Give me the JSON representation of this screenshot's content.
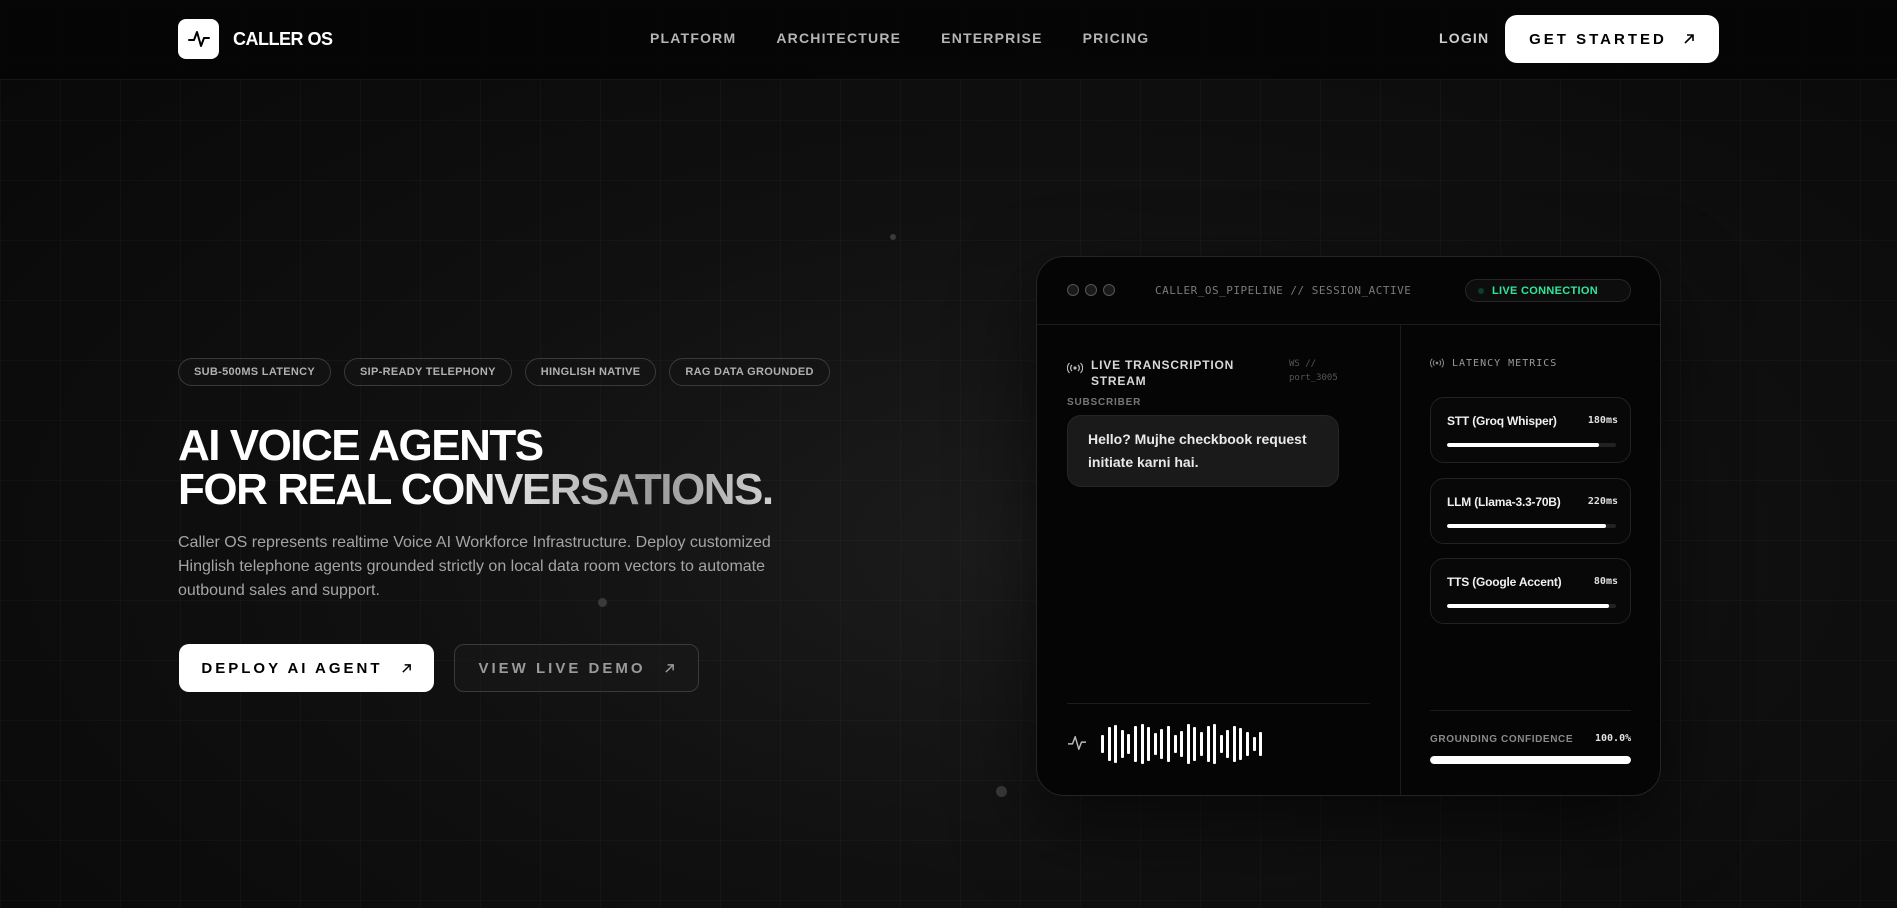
{
  "brand": {
    "name": "CALLER OS",
    "logo_icon": "pulse-icon"
  },
  "nav": {
    "items": [
      "PLATFORM",
      "ARCHITECTURE",
      "ENTERPRISE",
      "PRICING"
    ],
    "login": "LOGIN",
    "cta": "GET STARTED"
  },
  "hero": {
    "tags": [
      "SUB-500MS LATENCY",
      "SIP-READY TELEPHONY",
      "HINGLISH NATIVE",
      "RAG DATA GROUNDED"
    ],
    "title_line1": "AI VOICE AGENTS",
    "title_line2": "FOR REAL CONVERSATIONS.",
    "subtitle": "Caller OS represents realtime Voice AI Workforce Infrastructure. Deploy customized Hinglish telephone agents grounded strictly on local data room vectors to automate outbound sales and support.",
    "primary_cta": "DEPLOY AI AGENT",
    "secondary_cta": "VIEW LIVE DEMO"
  },
  "panel": {
    "pipeline": "CALLER_OS_PIPELINE // SESSION_ACTIVE",
    "status": "LIVE CONNECTION",
    "status_color": "#2ee89a",
    "transcription": {
      "title": "LIVE TRANSCRIPTION STREAM",
      "ws": "WS // port_3005",
      "speaker": "SUBSCRIBER",
      "message": "Hello? Mujhe checkbook request initiate karni hai."
    },
    "latency": {
      "title": "LATENCY METRICS",
      "metrics": [
        {
          "name": "STT (Groq Whisper)",
          "value": "180ms",
          "level": 0.9
        },
        {
          "name": "LLM (Llama-3.3-70B)",
          "value": "220ms",
          "level": 0.94
        },
        {
          "name": "TTS (Google Accent)",
          "value": "80ms",
          "level": 0.96
        }
      ]
    },
    "grounding": {
      "label": "GROUNDING CONFIDENCE",
      "value": "100.0%",
      "level": 1.0
    }
  }
}
